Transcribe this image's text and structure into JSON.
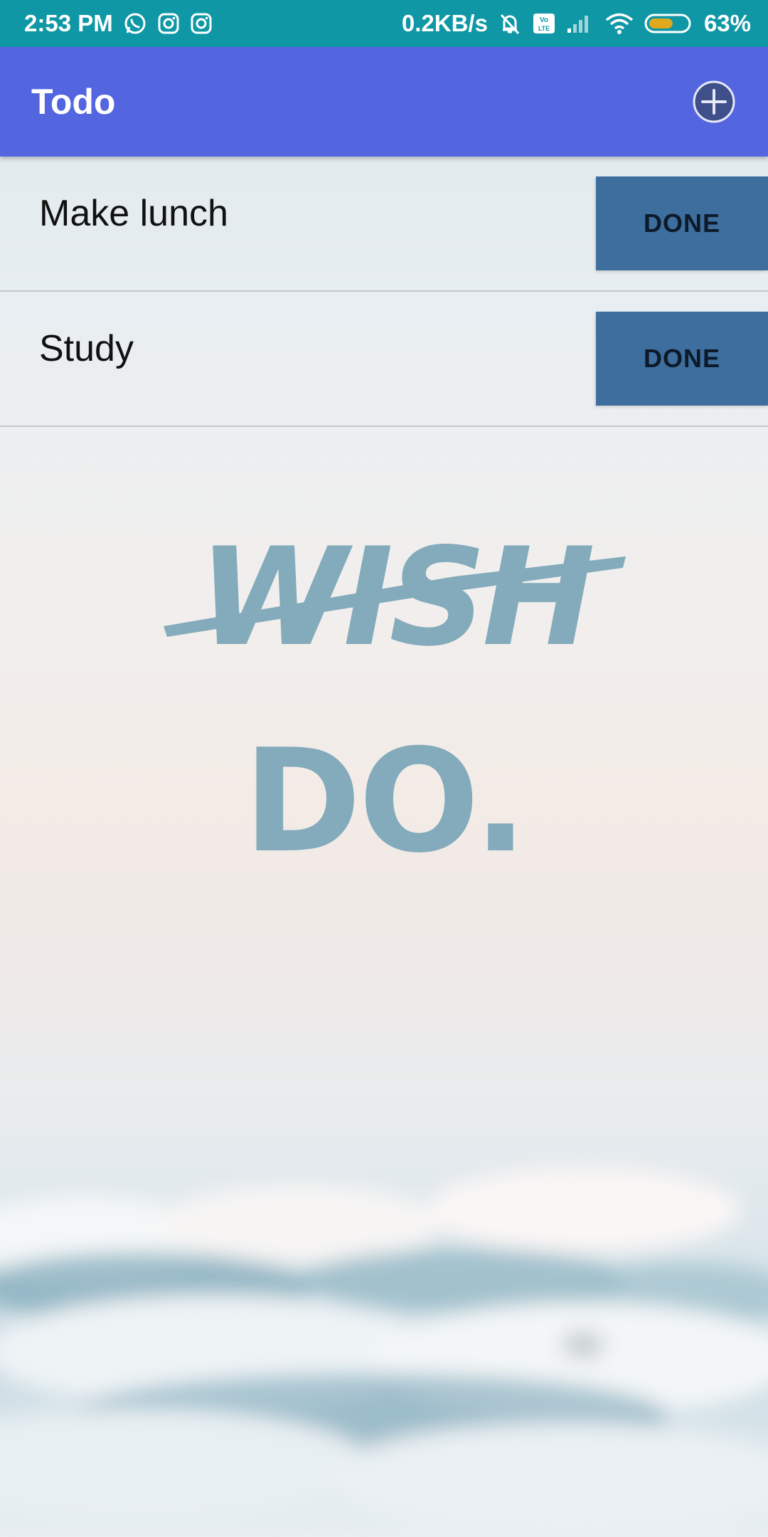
{
  "status_bar": {
    "time": "2:53 PM",
    "network_speed": "0.2KB/s",
    "battery_percent": "63%",
    "battery_level": 0.63,
    "icons": [
      "whatsapp-icon",
      "instagram-icon",
      "instagram-icon",
      "bell-muted-icon",
      "volte-icon",
      "signal-icon",
      "wifi-icon",
      "battery-icon"
    ]
  },
  "app_bar": {
    "title": "Todo",
    "add_icon": "add-circle-icon"
  },
  "todos": [
    {
      "text": "Make lunch",
      "button_label": "DONE"
    },
    {
      "text": "Study",
      "button_label": "DONE"
    }
  ],
  "background": {
    "artwork_text": [
      "WISH",
      "DO."
    ]
  },
  "colors": {
    "status_bar": "#0f97a5",
    "app_bar": "#5366e0",
    "done_button": "#3d6e9d",
    "artwork": "#7ea8b9"
  }
}
